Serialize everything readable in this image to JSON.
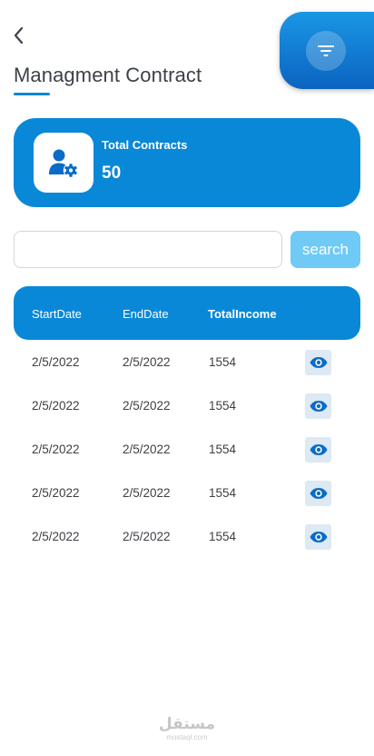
{
  "header": {
    "title": "Managment Contract",
    "back_icon": "chevron-left-icon",
    "filter_icon": "filter-icon"
  },
  "summary": {
    "label": "Total Contracts",
    "value": "50",
    "icon": "user-gear-icon"
  },
  "search": {
    "value": "",
    "placeholder": "",
    "button_label": "search"
  },
  "table": {
    "columns": [
      "StartDate",
      "EndDate",
      "TotalIncome"
    ],
    "rows": [
      {
        "start": "2/5/2022",
        "end": "2/5/2022",
        "income": "1554"
      },
      {
        "start": "2/5/2022",
        "end": "2/5/2022",
        "income": "1554"
      },
      {
        "start": "2/5/2022",
        "end": "2/5/2022",
        "income": "1554"
      },
      {
        "start": "2/5/2022",
        "end": "2/5/2022",
        "income": "1554"
      },
      {
        "start": "2/5/2022",
        "end": "2/5/2022",
        "income": "1554"
      }
    ],
    "row_action_icon": "eye-icon"
  },
  "watermark": {
    "text": "مستقل",
    "subtext": "mostaql.com"
  },
  "colors": {
    "primary": "#0a88d8",
    "filter_gradient_top": "#1a97e4",
    "filter_gradient_bottom": "#0b63c0",
    "search_button": "#6fcaf5",
    "view_button_bg": "#dde9f5",
    "icon_blue": "#0b6cc6",
    "text_dark": "#3c3f44"
  }
}
